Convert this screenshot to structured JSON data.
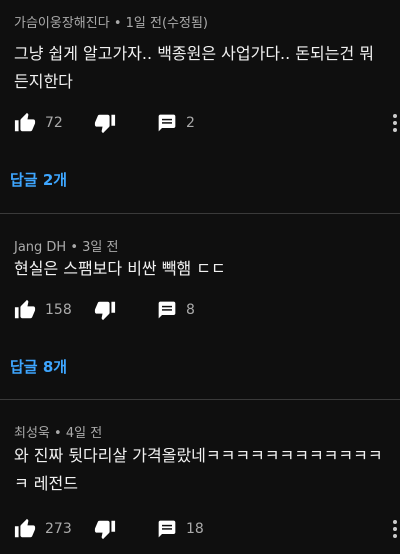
{
  "comments": [
    {
      "author": "가슴이웅장해진다",
      "time": "1일 전(수정됨)",
      "text": "그냥 쉽게 알고가자.. 백종원은 사업가다.. 돈되는건 뭐든지한다",
      "likes": "72",
      "replies_count": "2",
      "view_replies": "답글 2개"
    },
    {
      "author": "Jang DH",
      "time": "3일 전",
      "text": "현실은 스팸보다 비싼 빽햄 ㄷㄷ",
      "likes": "158",
      "replies_count": "8",
      "view_replies": "답글 8개"
    },
    {
      "author": "최성욱",
      "time": "4일 전",
      "text": "와 진짜 뒷다리살 가격올랐네ㅋㅋㅋㅋㅋㅋㅋㅋㅋㅋㅋㅋㅋ 레전드",
      "likes": "273",
      "replies_count": "18"
    }
  ],
  "separator": " • ",
  "icons": {
    "like": "thumbs-up-icon",
    "dislike": "thumbs-down-icon",
    "reply": "comment-icon",
    "more": "more-vertical-icon"
  },
  "colors": {
    "background": "#0f0f0f",
    "text": "#f1f1f1",
    "meta": "#aaaaaa",
    "link": "#3ea6ff",
    "divider": "#3a3a3a"
  }
}
